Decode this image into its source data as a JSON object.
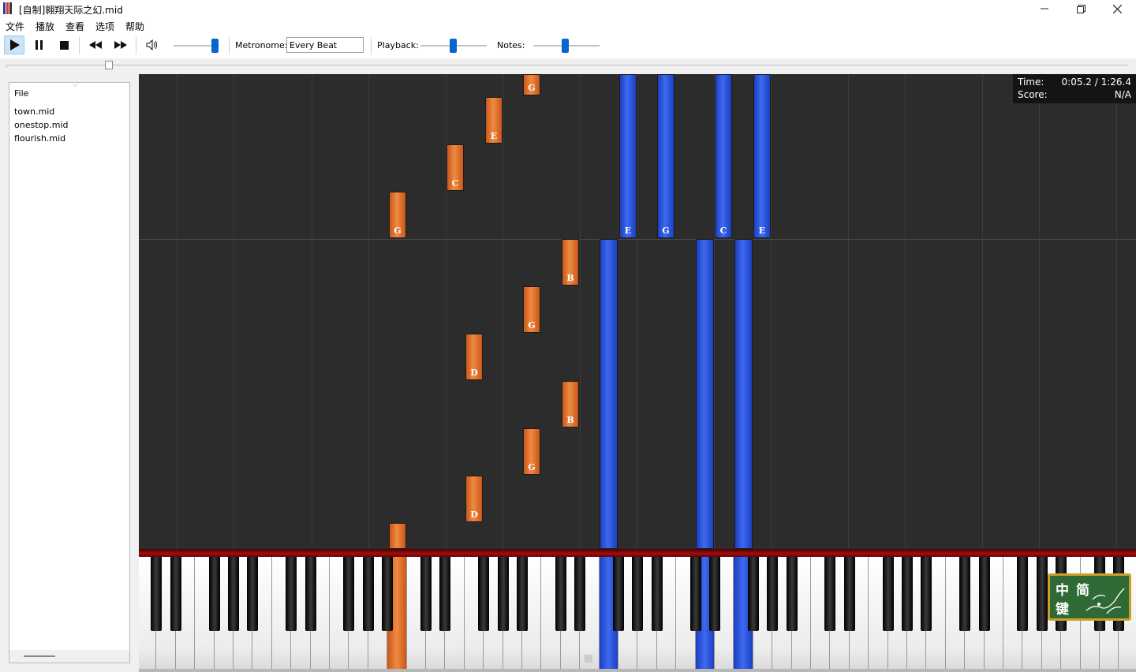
{
  "window": {
    "title": "[自制]翱翔天际之幻.mid",
    "controls": [
      "minimize",
      "restore",
      "close"
    ]
  },
  "menu": [
    "文件",
    "播放",
    "查看",
    "选项",
    "帮助"
  ],
  "toolbar": {
    "metronome_label": "Metronome:",
    "metronome_value": "Every Beat",
    "playback_label": "Playback:",
    "notes_label": "Notes:",
    "volume_level": 0.85,
    "playback_level": 0.5,
    "notes_level": 0.5
  },
  "progress": {
    "position": 0.06
  },
  "sidebar": {
    "header": "File",
    "files": [
      "town.mid",
      "onestop.mid",
      "flourish.mid"
    ]
  },
  "info": {
    "time_label": "Time:",
    "time_value": "0:05.2 / 1:26.4",
    "score_label": "Score:",
    "score_value": "N/A"
  },
  "colors": {
    "left_hand": "#e87a32",
    "right_hand": "#2d55e0",
    "roll_background": "#2c2c2c"
  },
  "notes": [
    {
      "name": "G",
      "hand": "left"
    },
    {
      "name": "E",
      "hand": "left"
    },
    {
      "name": "C",
      "hand": "left"
    },
    {
      "name": "G",
      "hand": "left"
    },
    {
      "name": "B",
      "hand": "left"
    },
    {
      "name": "G",
      "hand": "left"
    },
    {
      "name": "D",
      "hand": "left"
    },
    {
      "name": "B",
      "hand": "left"
    },
    {
      "name": "G",
      "hand": "left"
    },
    {
      "name": "D",
      "hand": "left"
    },
    {
      "name": "",
      "hand": "left"
    },
    {
      "name": "E",
      "hand": "right"
    },
    {
      "name": "G",
      "hand": "right"
    },
    {
      "name": "C",
      "hand": "right"
    },
    {
      "name": "E",
      "hand": "right"
    },
    {
      "name": "",
      "hand": "right"
    },
    {
      "name": "",
      "hand": "right"
    },
    {
      "name": "",
      "hand": "right"
    }
  ],
  "badge": {
    "chars": [
      "中",
      "简",
      "键"
    ]
  }
}
